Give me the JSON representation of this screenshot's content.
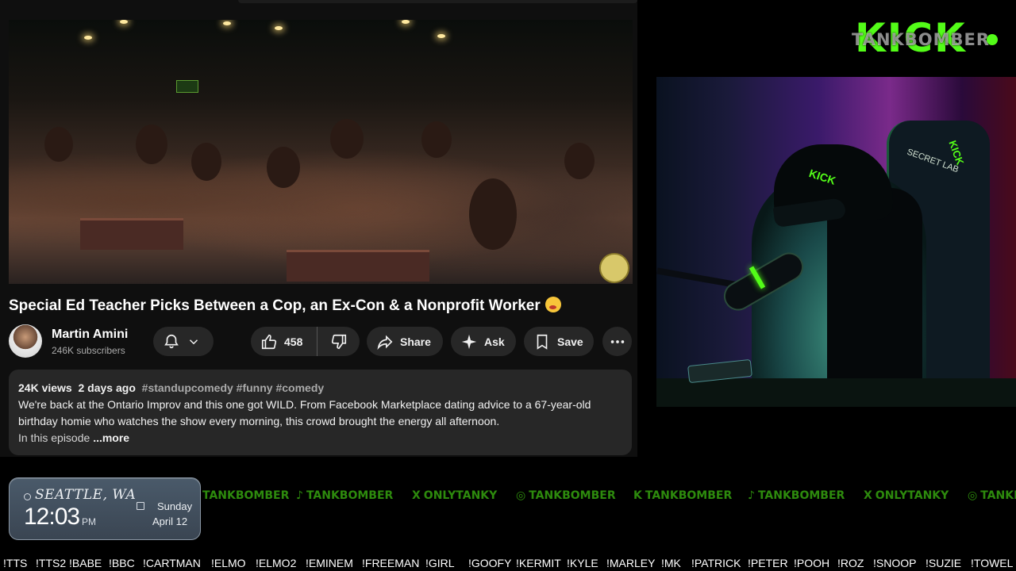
{
  "youtube": {
    "video_title": "Special Ed Teacher Picks Between a Cop, an Ex-Con & a Nonprofit Worker",
    "channel_name": "Martin Amini",
    "subscribers": "246K subscribers",
    "likes": "458",
    "share_label": "Share",
    "ask_label": "Ask",
    "save_label": "Save",
    "views": "24K views",
    "date": "2 days ago",
    "hashtags": "#standupcomedy #funny #comedy",
    "description_line1": "We're back at the Ontario Improv and this one got WILD. From Facebook Marketplace dating advice to a 67-year-old",
    "description_line2": "birthday homie who watches the show every morning, this crowd brought the energy all afternoon.",
    "description_line3": "In this episode",
    "more_label": "...more"
  },
  "kick": {
    "logo_text": "KICK",
    "username": "TANKBOMBER",
    "accent_color": "#53fc18"
  },
  "webcam": {
    "chair_brand": "SECRET LAB",
    "chair_logo": "KICK",
    "cap_logo": "KICK"
  },
  "clock": {
    "city": "SEATTLE, WA",
    "time": "12:03",
    "ampm": "PM",
    "day": "Sunday",
    "date": "April 12"
  },
  "socials": [
    {
      "icon": "kick-icon",
      "glyph": "",
      "text": "TANKBOMBER"
    },
    {
      "icon": "tiktok-icon",
      "glyph": "♪",
      "text": "TANKBOMBER"
    },
    {
      "icon": "x-icon",
      "glyph": "X",
      "text": "ONLYTANKY"
    },
    {
      "icon": "instagram-icon",
      "glyph": "◎",
      "text": "TANKBOMBER"
    },
    {
      "icon": "kick-icon",
      "glyph": "K",
      "text": "TANKBOMBER"
    },
    {
      "icon": "tiktok-icon",
      "glyph": "♪",
      "text": "TANKBOMBER"
    },
    {
      "icon": "x-icon",
      "glyph": "X",
      "text": "ONLYTANKY"
    },
    {
      "icon": "instagram-icon",
      "glyph": "◎",
      "text": "TANKBOMBER"
    }
  ],
  "commands": [
    "!TTS",
    "!TTS2",
    "!BABE",
    "!BBC",
    "!CARTMAN",
    "!ELMO",
    "!ELMO2",
    "!EMINEM",
    "!FREEMAN",
    "!GIRL",
    "!GOOFY",
    "!KERMIT",
    "!KYLE",
    "!MARLEY",
    "!MK",
    "!PATRICK",
    "!PETER",
    "!POOH",
    "!ROZ",
    "!SNOOP",
    "!SUZIE",
    "!TOWEL"
  ]
}
